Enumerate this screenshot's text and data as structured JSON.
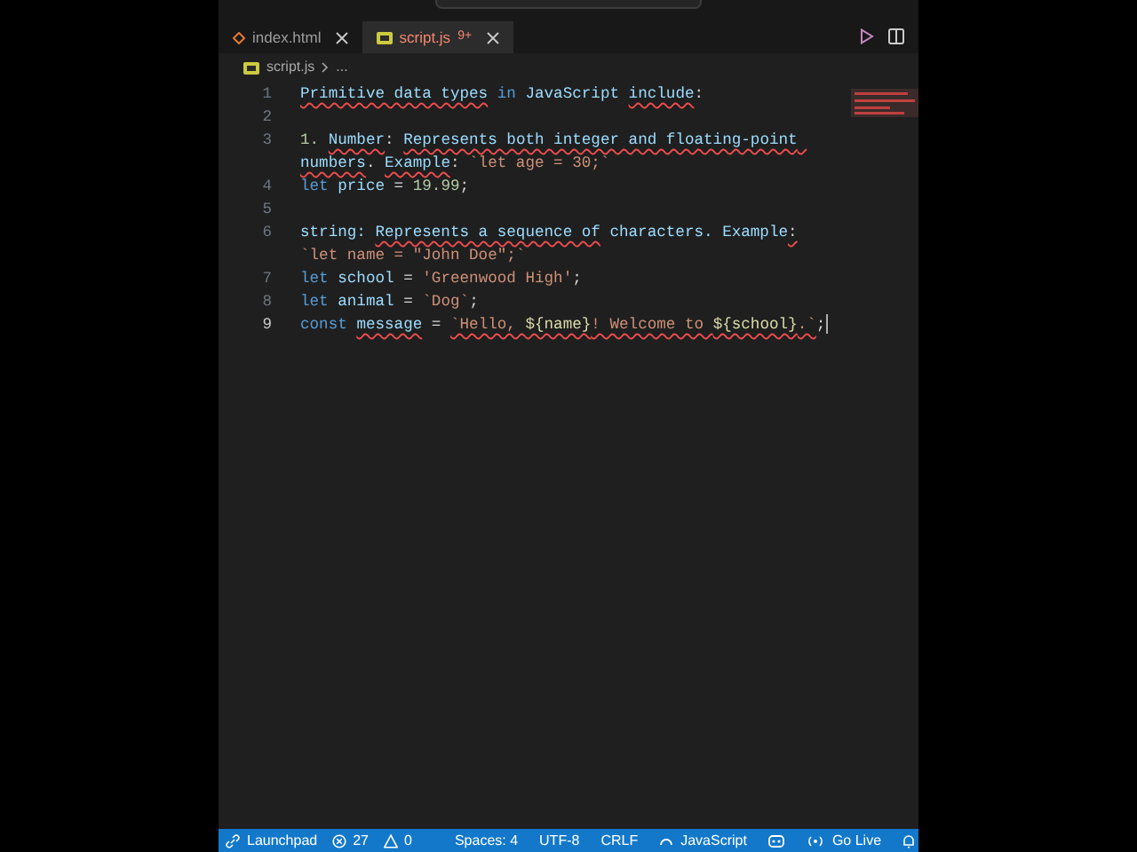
{
  "tabs": [
    {
      "label": "index.html",
      "kind": "html",
      "selected": false
    },
    {
      "label": "script.js",
      "kind": "js",
      "selected": true,
      "badge": "9+"
    }
  ],
  "breadcrumb": {
    "file": "script.js",
    "rest": "..."
  },
  "editor": {
    "lines": [
      {
        "number": "1",
        "segments": [
          {
            "text": "Primitive data types",
            "kind": "ident",
            "error": true
          },
          {
            "text": " in ",
            "kind": "keyword",
            "error": false
          },
          {
            "text": "JavaScript ",
            "kind": "ident",
            "error": false
          },
          {
            "text": "include",
            "kind": "ident",
            "error": true
          },
          {
            "text": ":",
            "kind": "plain",
            "error": false
          }
        ]
      },
      {
        "number": "2"
      },
      {
        "number": "3",
        "segments": [
          {
            "text": "1. ",
            "kind": "number",
            "error": false
          },
          {
            "text": "Number",
            "kind": "ident",
            "error": true
          },
          {
            "text": ": ",
            "kind": "plain",
            "error": false
          },
          {
            "text": "Represents both integer and floating-point numbers",
            "kind": "ident",
            "error": true
          },
          {
            "text": ". ",
            "kind": "plain",
            "error": false
          },
          {
            "text": "Example",
            "kind": "ident",
            "error": true
          },
          {
            "text": ": ",
            "kind": "plain",
            "error": false
          },
          {
            "text": "`let age = 30;`",
            "kind": "string",
            "error": false
          }
        ]
      },
      {
        "number": "4",
        "segments": [
          {
            "text": "let ",
            "kind": "keyword",
            "error": false
          },
          {
            "text": "price",
            "kind": "ident",
            "error": false
          },
          {
            "text": " = ",
            "kind": "plain",
            "error": false
          },
          {
            "text": "19.99",
            "kind": "number",
            "error": false
          },
          {
            "text": ";",
            "kind": "plain",
            "error": false
          }
        ]
      },
      {
        "number": "5"
      },
      {
        "number": "6",
        "segments": [
          {
            "text": "string: ",
            "kind": "ident",
            "error": false
          },
          {
            "text": "Represents a sequence of",
            "kind": "ident",
            "error": true
          },
          {
            "text": " characters. Example",
            "kind": "ident",
            "error": false
          },
          {
            "text": ":",
            "kind": "plain",
            "error": true
          },
          {
            "text": " `let name = \"John Doe\";`",
            "kind": "string",
            "error": false
          }
        ]
      },
      {
        "number": "7",
        "segments": [
          {
            "text": "let ",
            "kind": "keyword",
            "error": false
          },
          {
            "text": "school",
            "kind": "ident",
            "error": false
          },
          {
            "text": " = ",
            "kind": "plain",
            "error": false
          },
          {
            "text": "'Greenwood High'",
            "kind": "string",
            "error": false
          },
          {
            "text": ";",
            "kind": "plain",
            "error": false
          }
        ]
      },
      {
        "number": "8",
        "segments": [
          {
            "text": "let ",
            "kind": "keyword",
            "error": false
          },
          {
            "text": "animal",
            "kind": "ident",
            "error": false
          },
          {
            "text": " = ",
            "kind": "plain",
            "error": false
          },
          {
            "text": "`Dog`",
            "kind": "string",
            "error": false
          },
          {
            "text": ";",
            "kind": "plain",
            "error": false
          }
        ]
      },
      {
        "number": "9",
        "current": true,
        "segments": [
          {
            "text": "const ",
            "kind": "keyword",
            "error": false
          },
          {
            "text": "message",
            "kind": "ident",
            "error": true
          },
          {
            "text": " = ",
            "kind": "plain",
            "error": false
          },
          {
            "text": "`Hello, ",
            "kind": "string",
            "error": true
          },
          {
            "text": "${name}",
            "kind": "interp",
            "error": true
          },
          {
            "text": "! Welcome to ",
            "kind": "string",
            "error": true
          },
          {
            "text": "${school}",
            "kind": "interp",
            "error": true
          },
          {
            "text": ".`",
            "kind": "string",
            "error": true
          },
          {
            "text": ";",
            "kind": "plain",
            "error": false
          }
        ]
      }
    ]
  },
  "status_bar": {
    "left": [
      {
        "label": "Launchpad",
        "kind": "launchpad"
      },
      {
        "label": "27",
        "kind": "errors"
      },
      {
        "label": "0",
        "kind": "warnings"
      }
    ],
    "right": [
      {
        "label": "Spaces: 4",
        "kind": "text"
      },
      {
        "label": "UTF-8",
        "kind": "text"
      },
      {
        "label": "CRLF",
        "kind": "text"
      },
      {
        "label": "JavaScript",
        "kind": "language"
      },
      {
        "kind": "copilot"
      },
      {
        "label": "Go Live",
        "kind": "golive"
      }
    ]
  }
}
